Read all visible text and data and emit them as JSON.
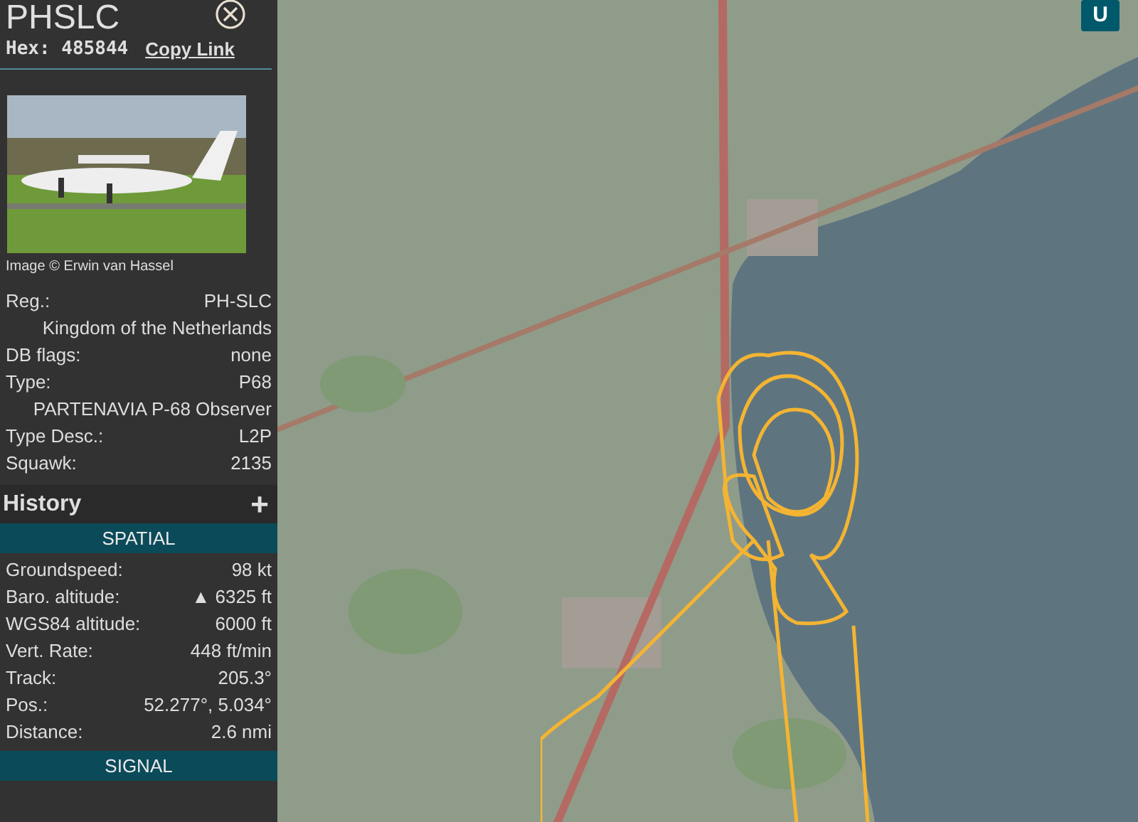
{
  "aircraft": {
    "callsign": "PHSLC",
    "hex_label": "Hex:",
    "hex": "485844",
    "copy_link": "Copy Link"
  },
  "photo": {
    "credit": "Image © Erwin van Hassel"
  },
  "details": [
    {
      "kind": "field",
      "label": "Reg.:",
      "value": "PH-SLC"
    },
    {
      "kind": "note",
      "value": "Kingdom of the Netherlands"
    },
    {
      "kind": "field",
      "label": "DB flags:",
      "value": "none"
    },
    {
      "kind": "field",
      "label": "Type:",
      "value": "P68"
    },
    {
      "kind": "note",
      "value": "PARTENAVIA P-68 Observer"
    },
    {
      "kind": "field",
      "label": "Type Desc.:",
      "value": "L2P"
    },
    {
      "kind": "field",
      "label": "Squawk:",
      "value": "2135"
    }
  ],
  "history": {
    "title": "History",
    "toggle": "+"
  },
  "sections": [
    {
      "title": "SPATIAL",
      "rows": [
        {
          "kind": "field",
          "label": "Groundspeed:",
          "value": "98 kt"
        },
        {
          "kind": "field",
          "label": "Baro. altitude:",
          "value": "▲ 6325 ft"
        },
        {
          "kind": "field",
          "label": "WGS84 altitude:",
          "value": "6000 ft"
        },
        {
          "kind": "field",
          "label": "Vert. Rate:",
          "value": "448 ft/min"
        },
        {
          "kind": "field",
          "label": "Track:",
          "value": "205.3°"
        },
        {
          "kind": "field",
          "label": "Pos.:",
          "value": "52.277°, 5.034°"
        },
        {
          "kind": "field",
          "label": "Distance:",
          "value": "2.6 nmi"
        }
      ]
    },
    {
      "title": "SIGNAL"
    }
  ],
  "map": {
    "buttons": [
      "U"
    ]
  }
}
